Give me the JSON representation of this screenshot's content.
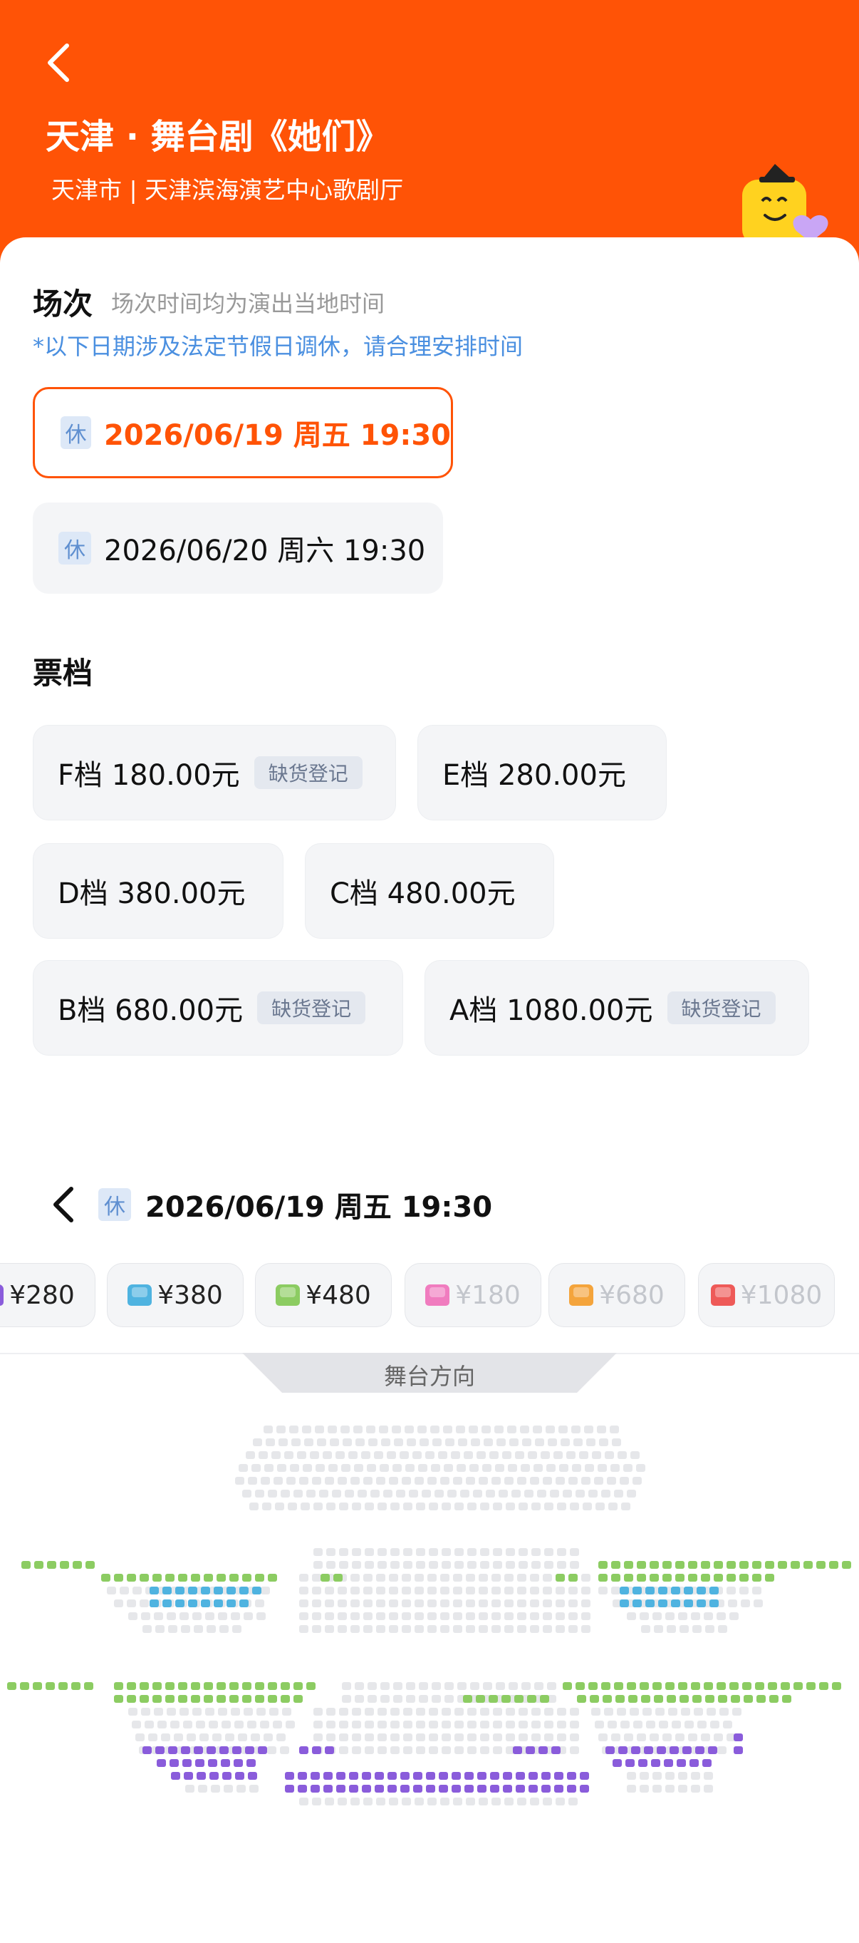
{
  "header": {
    "title": "天津 · 舞台剧《她们》",
    "subtitle": "天津市 | 天津滨海演艺中心歌剧厅"
  },
  "sessions": {
    "title": "场次",
    "hint": "场次时间均为演出当地时间",
    "notice": "*以下日期涉及法定节假日调休，请合理安排时间",
    "items": [
      {
        "badge": "休",
        "label": "2026/06/19 周五 19:30",
        "selected": true
      },
      {
        "badge": "休",
        "label": "2026/06/20 周六 19:30",
        "selected": false
      }
    ]
  },
  "tiers": {
    "title": "票档",
    "items": [
      {
        "label": "F档 180.00元",
        "badge": "缺货登记"
      },
      {
        "label": "E档 280.00元",
        "badge": ""
      },
      {
        "label": "D档 380.00元",
        "badge": ""
      },
      {
        "label": "C档 480.00元",
        "badge": ""
      },
      {
        "label": "B档 680.00元",
        "badge": "缺货登记"
      },
      {
        "label": "A档 1080.00元",
        "badge": "缺货登记"
      }
    ]
  },
  "seat_map": {
    "badge": "休",
    "session_label": "2026/06/19 周五 19:30",
    "stage_label": "舞台方向",
    "price_chips": [
      {
        "label": "¥280",
        "color": "#8a5cdb",
        "available": true
      },
      {
        "label": "¥380",
        "color": "#4fb3e0",
        "available": true
      },
      {
        "label": "¥480",
        "color": "#8ccc62",
        "available": true
      },
      {
        "label": "¥180",
        "color": "#f07cbf",
        "available": false
      },
      {
        "label": "¥680",
        "color": "#f4a43c",
        "available": false
      },
      {
        "label": "¥1080",
        "color": "#ee5a58",
        "available": false
      }
    ],
    "seat_colors": {
      "unavailable": "#e6e7ea",
      "purple": "#8a5cdb",
      "blue": "#4fb3e0",
      "green": "#8ccc62"
    }
  },
  "colors": {
    "brand": "#ff5306",
    "notice": "#4a8fe0"
  }
}
